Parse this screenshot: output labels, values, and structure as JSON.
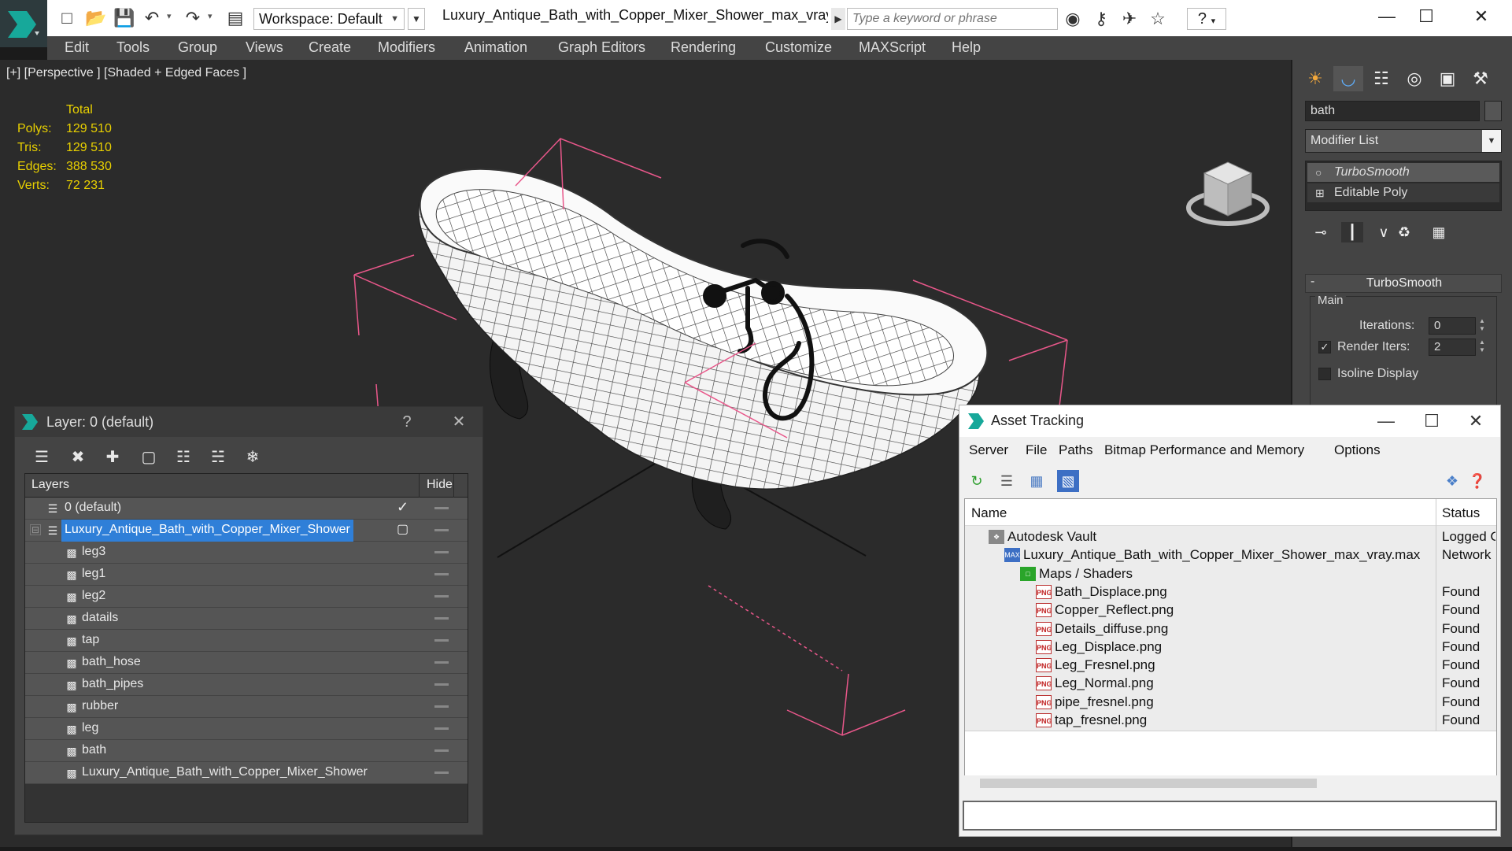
{
  "titlebar": {
    "workspace_label": "Workspace: Default",
    "doc_title": "Luxury_Antique_Bath_with_Copper_Mixer_Shower_max_vray...",
    "search_placeholder": "Type a keyword or phrase",
    "help_label": "?"
  },
  "menu": [
    "Edit",
    "Tools",
    "Group",
    "Views",
    "Create",
    "Modifiers",
    "Animation",
    "Graph Editors",
    "Rendering",
    "Customize",
    "MAXScript",
    "Help"
  ],
  "viewport": {
    "label": "[+] [Perspective ] [Shaded + Edged Faces ]",
    "stats": {
      "header": "Total",
      "rows": [
        {
          "label": "Polys:",
          "value": "129 510"
        },
        {
          "label": "Tris:",
          "value": "129 510"
        },
        {
          "label": "Edges:",
          "value": "388 530"
        },
        {
          "label": "Verts:",
          "value": "72 231"
        }
      ]
    }
  },
  "command_panel": {
    "object_name": "bath",
    "modifier_list": "Modifier List",
    "stack": [
      "TurboSmooth",
      "Editable Poly"
    ],
    "rollout_title": "TurboSmooth",
    "main_group": "Main",
    "iterations_label": "Iterations:",
    "iterations_value": "0",
    "render_iters_label": "Render Iters:",
    "render_iters_value": "2",
    "isoline_label": "Isoline Display"
  },
  "layer_dialog": {
    "title": "Layer: 0 (default)",
    "help": "?",
    "col_layers": "Layers",
    "col_hide": "Hide",
    "rows": [
      {
        "name": "0 (default)",
        "level": 0,
        "current": true
      },
      {
        "name": "Luxury_Antique_Bath_with_Copper_Mixer_Shower",
        "level": 0,
        "selected": true
      },
      {
        "name": "leg3",
        "level": 1
      },
      {
        "name": "leg1",
        "level": 1
      },
      {
        "name": "leg2",
        "level": 1
      },
      {
        "name": "datails",
        "level": 1
      },
      {
        "name": "tap",
        "level": 1
      },
      {
        "name": "bath_hose",
        "level": 1
      },
      {
        "name": "bath_pipes",
        "level": 1
      },
      {
        "name": "rubber",
        "level": 1
      },
      {
        "name": "leg",
        "level": 1
      },
      {
        "name": "bath",
        "level": 1
      },
      {
        "name": "Luxury_Antique_Bath_with_Copper_Mixer_Shower",
        "level": 1
      }
    ]
  },
  "asset_dialog": {
    "title": "Asset Tracking",
    "menu": [
      "Server",
      "File",
      "Paths",
      "Bitmap Performance and Memory",
      "Options"
    ],
    "col_name": "Name",
    "col_status": "Status",
    "rows": [
      {
        "name": "Autodesk Vault",
        "status": "Logged Out",
        "indent": 1,
        "icon": "vault"
      },
      {
        "name": "Luxury_Antique_Bath_with_Copper_Mixer_Shower_max_vray.max",
        "status": "Network",
        "indent": 2,
        "icon": "max"
      },
      {
        "name": "Maps / Shaders",
        "status": "",
        "indent": 3,
        "icon": "maps"
      },
      {
        "name": "Bath_Displace.png",
        "status": "Found",
        "indent": 4,
        "icon": "png"
      },
      {
        "name": "Copper_Reflect.png",
        "status": "Found",
        "indent": 4,
        "icon": "png"
      },
      {
        "name": "Details_diffuse.png",
        "status": "Found",
        "indent": 4,
        "icon": "png"
      },
      {
        "name": "Leg_Displace.png",
        "status": "Found",
        "indent": 4,
        "icon": "png"
      },
      {
        "name": "Leg_Fresnel.png",
        "status": "Found",
        "indent": 4,
        "icon": "png"
      },
      {
        "name": "Leg_Normal.png",
        "status": "Found",
        "indent": 4,
        "icon": "png"
      },
      {
        "name": "pipe_fresnel.png",
        "status": "Found",
        "indent": 4,
        "icon": "png"
      },
      {
        "name": "tap_fresnel.png",
        "status": "Found",
        "indent": 4,
        "icon": "png"
      }
    ]
  },
  "colors": {
    "accent_selection": "#2f7fd8",
    "stats_yellow": "#e8d000",
    "selection_bracket": "#e8578a"
  }
}
